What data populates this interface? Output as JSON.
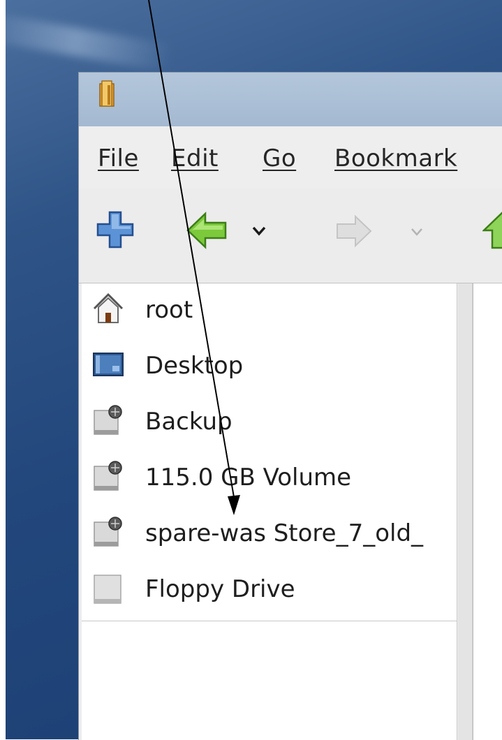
{
  "menu": [
    {
      "label": "File"
    },
    {
      "label": "Edit"
    },
    {
      "label": "Go"
    },
    {
      "label": "Bookmark"
    }
  ],
  "toolbar": {
    "buttons": [
      {
        "icon": "new-tab-plus-icon"
      },
      {
        "icon": "back-arrow-icon"
      },
      {
        "icon": "back-history-chevron-icon"
      },
      {
        "icon": "forward-arrow-icon"
      },
      {
        "icon": "forward-history-chevron-icon"
      },
      {
        "icon": "up-arrow-icon"
      }
    ]
  },
  "sidebar": {
    "items": [
      {
        "label": "root",
        "icon": "home-icon"
      },
      {
        "label": "Desktop",
        "icon": "desktop-icon"
      },
      {
        "label": "Backup",
        "icon": "drive-icon"
      },
      {
        "label": "115.0 GB Volume",
        "icon": "drive-icon"
      },
      {
        "label": "spare-was Store_7_old_",
        "icon": "drive-icon"
      },
      {
        "label": "Floppy Drive",
        "icon": "floppy-drive-icon"
      }
    ]
  },
  "colors": {
    "desktop": "#22477c",
    "titlebar": "#a4b9d1",
    "window": "#ededed",
    "back_arrow": "#6ec22f",
    "plus_icon": "#3b78c4"
  }
}
